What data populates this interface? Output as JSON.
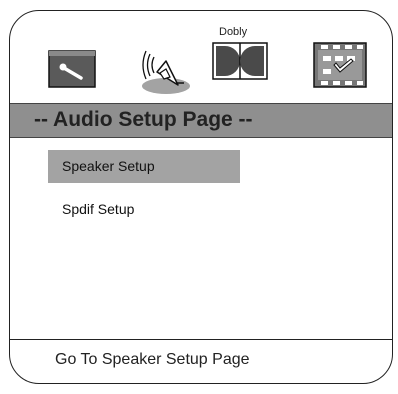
{
  "toolbar": {
    "icons": [
      {
        "name": "general-setup-icon"
      },
      {
        "name": "audio-setup-icon"
      },
      {
        "name": "dolby-setup-icon",
        "label": "Dobly"
      },
      {
        "name": "preference-setup-icon"
      }
    ]
  },
  "header": {
    "title": "-- Audio Setup Page --"
  },
  "menu": {
    "items": [
      {
        "label": "Speaker Setup",
        "selected": true
      },
      {
        "label": "Spdif Setup",
        "selected": false
      }
    ]
  },
  "footer": {
    "status": "Go To Speaker Setup Page"
  },
  "colors": {
    "header_bg": "#8f8f8f",
    "selected_bg": "#a3a3a3",
    "border": "#222222"
  }
}
